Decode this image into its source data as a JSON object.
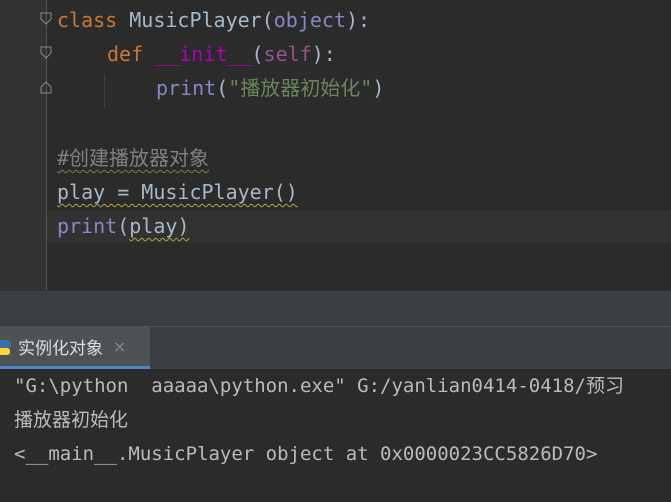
{
  "editor": {
    "code": {
      "line1": {
        "kw": "class",
        "name": " MusicPlayer(",
        "base": "object",
        "end": "):"
      },
      "line2": {
        "kw": "def",
        "fn": "__init__",
        "open": "(",
        "self": "self",
        "end": "):"
      },
      "line3": {
        "fn": "print",
        "open": "(",
        "str": "\"播放器初始化\"",
        "end": ")"
      },
      "line4": {
        "comment": "#创建播放器对象"
      },
      "line5": {
        "text": "play = MusicPlayer()"
      },
      "line6": {
        "fn": "print",
        "open": "(",
        "arg": "play",
        "end": ")"
      }
    }
  },
  "run_panel": {
    "tab_label": "实例化对象",
    "tab_close": "×",
    "output": [
      "\"G:\\python  aaaaa\\python.exe\" G:/yanlian0414-0418/预习",
      "播放器初始化",
      "<__main__.MusicPlayer object at 0x0000023CC5826D70>"
    ]
  },
  "colors": {
    "keyword": "#cc7832",
    "string": "#6a8759",
    "builtin": "#8888c6",
    "comment": "#808080",
    "background": "#2b2b2b"
  }
}
